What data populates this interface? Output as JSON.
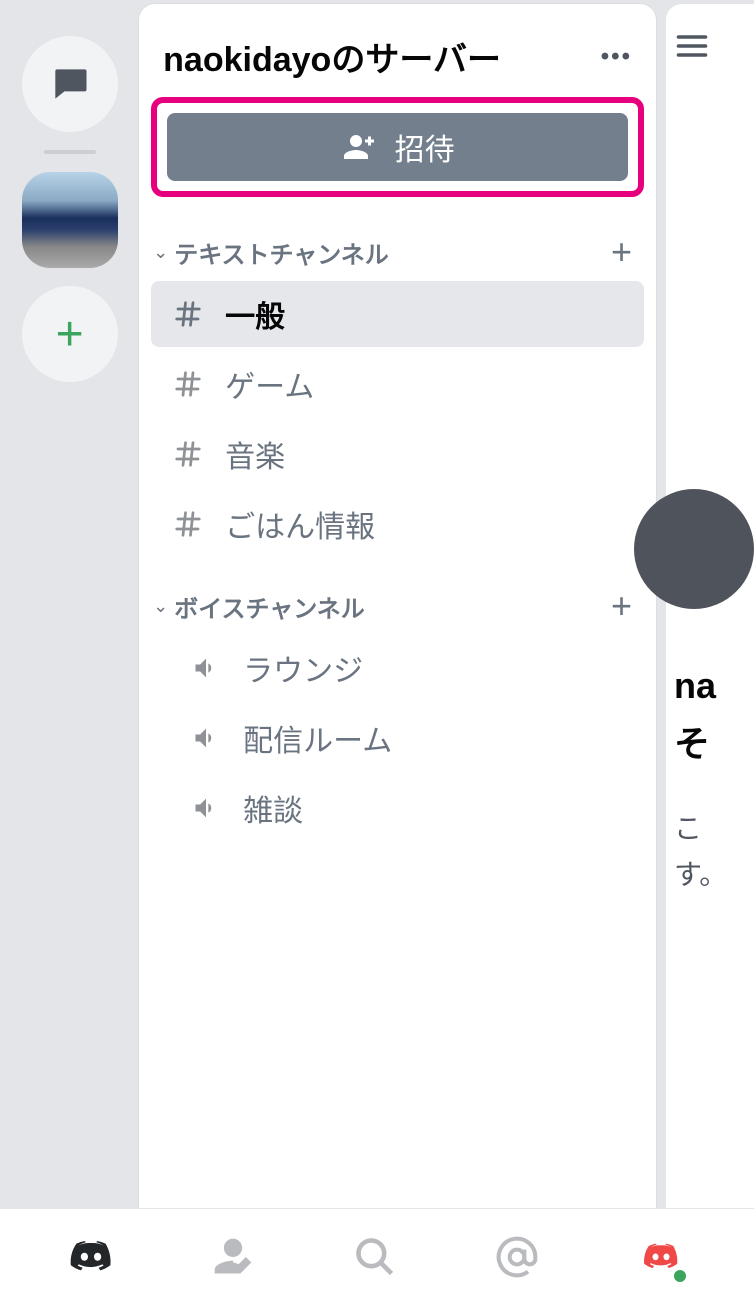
{
  "server": {
    "title": "naokidayoのサーバー"
  },
  "invite": {
    "label": "招待"
  },
  "categories": {
    "text": {
      "label": "テキストチャンネル",
      "channels": [
        {
          "name": "一般",
          "selected": true
        },
        {
          "name": "ゲーム",
          "selected": false
        },
        {
          "name": "音楽",
          "selected": false
        },
        {
          "name": "ごはん情報",
          "selected": false
        }
      ]
    },
    "voice": {
      "label": "ボイスチャンネル",
      "channels": [
        {
          "name": "ラウンジ"
        },
        {
          "name": "配信ルーム"
        },
        {
          "name": "雑談"
        }
      ]
    }
  },
  "peek": {
    "line1": "na",
    "line2": "そ",
    "line3": "こ",
    "line4": "す。"
  }
}
